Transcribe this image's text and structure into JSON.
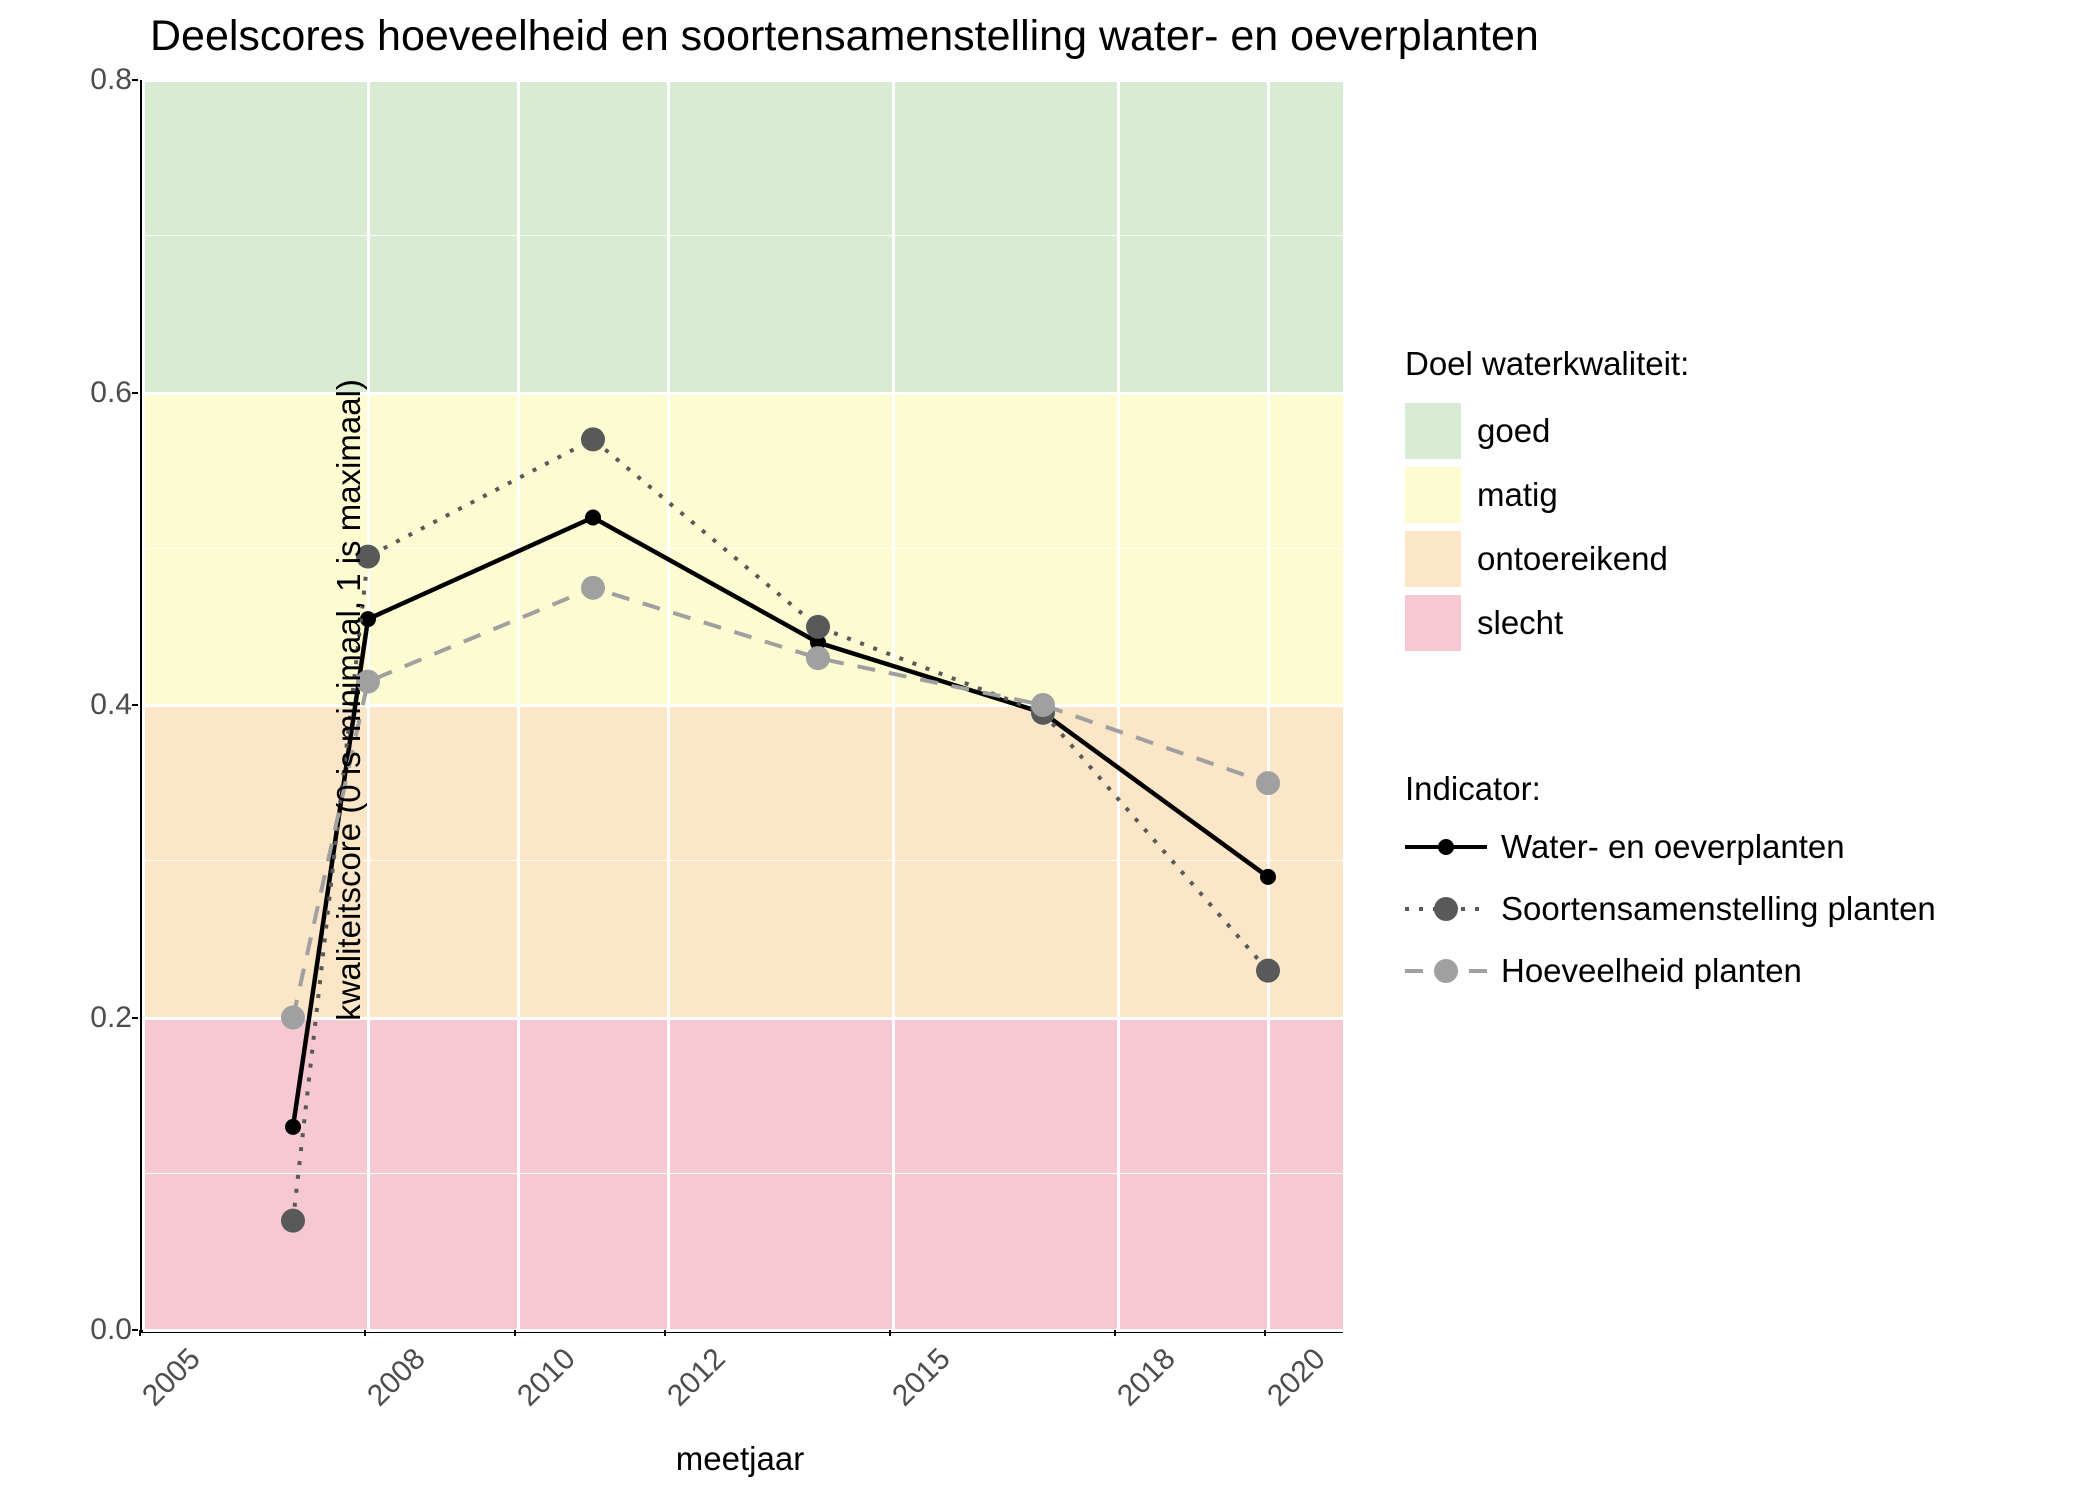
{
  "title": "Deelscores hoeveelheid en soortensamenstelling water- en oeverplanten",
  "xlabel": "meetjaar",
  "ylabel": "kwaliteitscore (0 is minimaal, 1 is maximaal)",
  "legend_quality": {
    "title": "Doel waterkwaliteit:",
    "items": [
      "goed",
      "matig",
      "ontoereikend",
      "slecht"
    ]
  },
  "legend_indicator": {
    "title": "Indicator:",
    "items": [
      "Water- en oeverplanten",
      "Soortensamenstelling planten",
      "Hoeveelheid planten"
    ]
  },
  "yticks": [
    "0.0",
    "0.2",
    "0.4",
    "0.6",
    "0.8"
  ],
  "xticks": [
    "2005",
    "2008",
    "2010",
    "2012",
    "2015",
    "2018",
    "2020"
  ],
  "chart_data": {
    "type": "line",
    "title": "Deelscores hoeveelheid en soortensamenstelling water- en oeverplanten",
    "xlabel": "meetjaar",
    "ylabel": "kwaliteitscore (0 is minimaal, 1 is maximaal)",
    "xlim": [
      2005,
      2021
    ],
    "ylim": [
      0.0,
      0.8
    ],
    "x": [
      2007,
      2008,
      2011,
      2014,
      2017,
      2020
    ],
    "series": [
      {
        "name": "Water- en oeverplanten",
        "style": "solid",
        "color": "#000000",
        "values": [
          0.13,
          0.455,
          0.52,
          0.44,
          0.395,
          0.29
        ]
      },
      {
        "name": "Soortensamenstelling planten",
        "style": "dotted",
        "color": "#595959",
        "values": [
          0.07,
          0.495,
          0.57,
          0.45,
          0.395,
          0.23
        ]
      },
      {
        "name": "Hoeveelheid planten",
        "style": "dashed",
        "color": "#a0a0a0",
        "values": [
          0.2,
          0.415,
          0.475,
          0.43,
          0.4,
          0.35
        ]
      }
    ],
    "bands": [
      {
        "name": "goed",
        "from": 0.6,
        "to": 0.8,
        "color": "#d9ecd3"
      },
      {
        "name": "matig",
        "from": 0.4,
        "to": 0.6,
        "color": "#fdfbd2"
      },
      {
        "name": "ontoereikend",
        "from": 0.2,
        "to": 0.4,
        "color": "#fbe6c8"
      },
      {
        "name": "slecht",
        "from": 0.0,
        "to": 0.2,
        "color": "#f6c9d2"
      }
    ]
  }
}
